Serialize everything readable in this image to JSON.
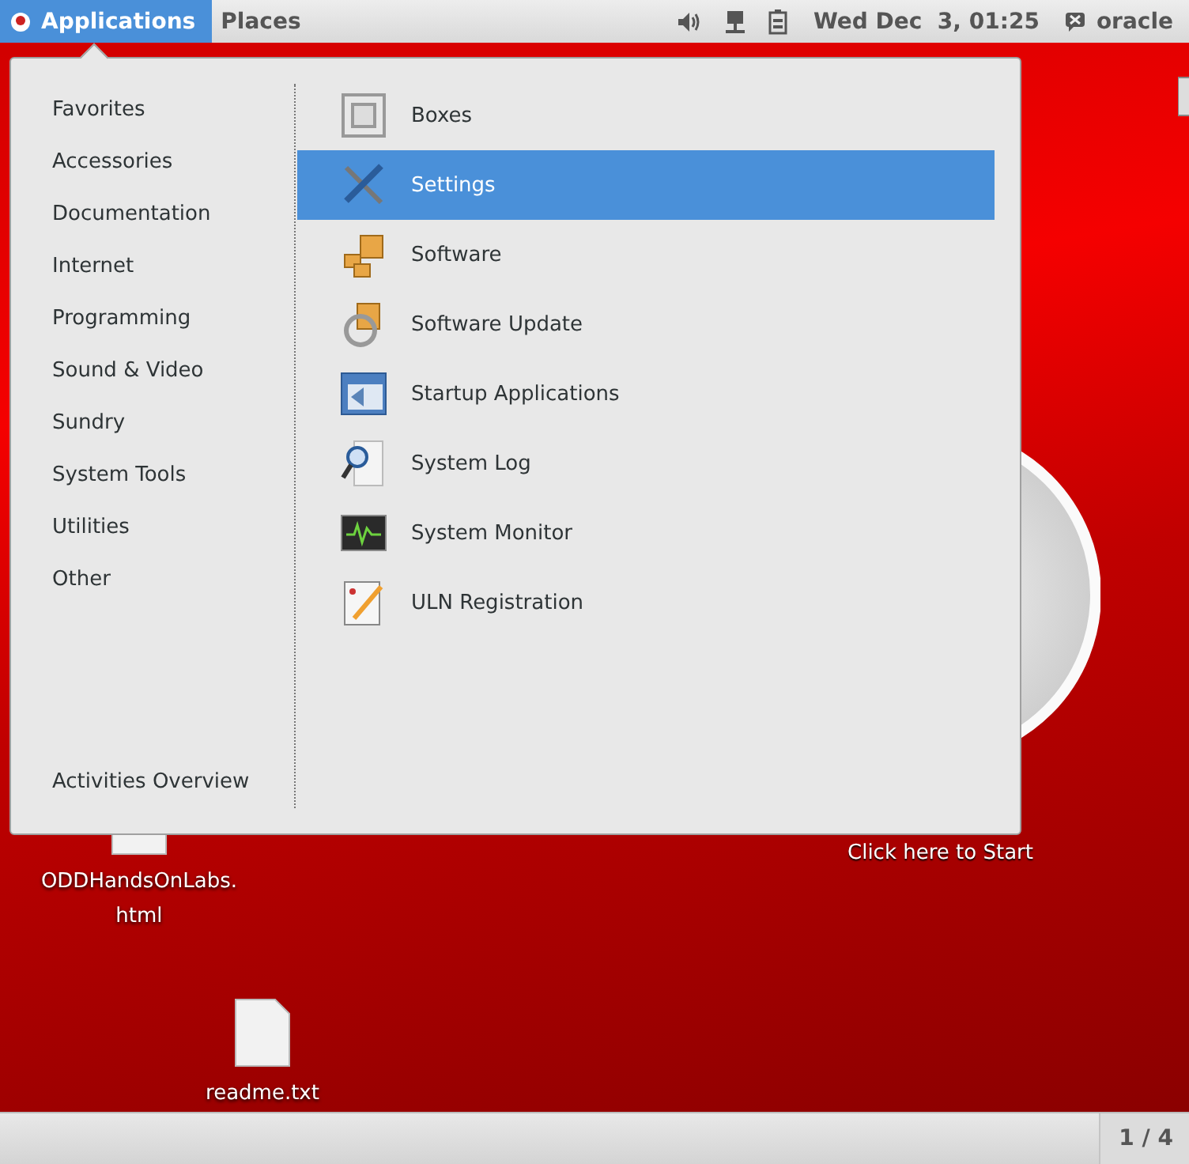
{
  "top_bar": {
    "applications": {
      "label": "Applications",
      "selected": true
    },
    "places": {
      "label": "Places",
      "selected": false
    },
    "clock": "Wed Dec  3, 01:25",
    "user": "oracle"
  },
  "menu": {
    "categories": [
      {
        "label": "Favorites"
      },
      {
        "label": "Accessories"
      },
      {
        "label": "Documentation"
      },
      {
        "label": "Internet"
      },
      {
        "label": "Programming"
      },
      {
        "label": "Sound & Video"
      },
      {
        "label": "Sundry"
      },
      {
        "label": "System Tools"
      },
      {
        "label": "Utilities"
      },
      {
        "label": "Other"
      }
    ],
    "activities": "Activities Overview",
    "apps": [
      {
        "label": "Boxes",
        "kind": "boxes",
        "selected": false
      },
      {
        "label": "Settings",
        "kind": "settings",
        "selected": true
      },
      {
        "label": "Software",
        "kind": "software",
        "selected": false
      },
      {
        "label": "Software Update",
        "kind": "update",
        "selected": false
      },
      {
        "label": "Startup Applications",
        "kind": "startup",
        "selected": false
      },
      {
        "label": "System Log",
        "kind": "log",
        "selected": false
      },
      {
        "label": "System Monitor",
        "kind": "monitor",
        "selected": false
      },
      {
        "label": "ULN Registration",
        "kind": "registration",
        "selected": false
      }
    ]
  },
  "desktop": {
    "icons": [
      {
        "label": "ODDHandsOnLabs.\nhtml"
      },
      {
        "label": "readme.txt"
      }
    ],
    "start_caption": "Click here to Start"
  },
  "bottom_bar": {
    "workspace": "1 / 4"
  }
}
